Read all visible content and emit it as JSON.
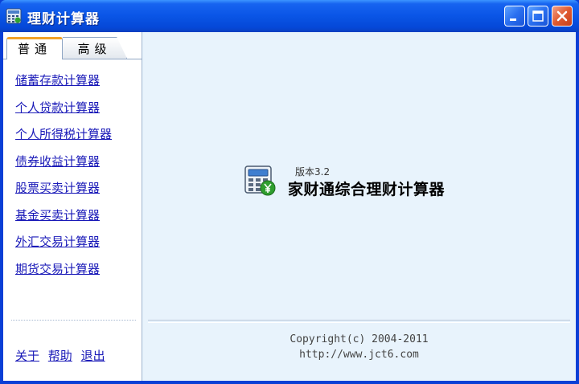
{
  "window": {
    "title": "理财计算器",
    "accent_color": "#0a55e6",
    "icon": "calculator-icon"
  },
  "titlebar_buttons": {
    "minimize_icon": "minimize-icon",
    "maximize_icon": "maximize-icon",
    "close_icon": "close-icon"
  },
  "tabs": [
    {
      "label": "普通",
      "active": true
    },
    {
      "label": "高级",
      "active": false
    }
  ],
  "nav": {
    "items": [
      {
        "label": "储蓄存款计算器"
      },
      {
        "label": "个人贷款计算器"
      },
      {
        "label": "个人所得税计算器"
      },
      {
        "label": "债券收益计算器"
      },
      {
        "label": "股票买卖计算器"
      },
      {
        "label": "基金买卖计算器"
      },
      {
        "label": "外汇交易计算器"
      },
      {
        "label": "期货交易计算器"
      }
    ]
  },
  "footer_links": {
    "about": "关于",
    "help": "帮助",
    "exit": "退出"
  },
  "main": {
    "logo_icon": "yuan-calculator-icon",
    "version": "版本3.2",
    "product_name": "家财通综合理财计算器",
    "copyright": "Copyright(c) 2004-2011",
    "url": "http://www.jct6.com"
  }
}
